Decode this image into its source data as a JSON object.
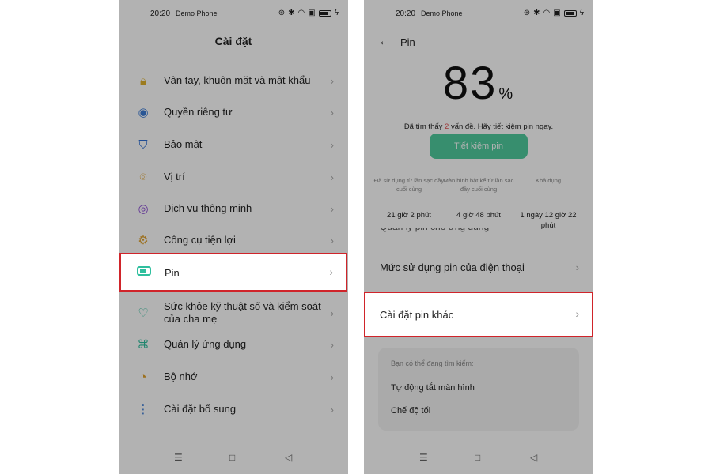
{
  "status_bar": {
    "time": "20:20",
    "carrier": "Demo Phone"
  },
  "left_screen": {
    "title": "Cài đặt",
    "items": [
      {
        "label": "Vân tay, khuôn mặt và mật khẩu",
        "icon": "lock-icon"
      },
      {
        "label": "Quyền riêng tư",
        "icon": "privacy-eye-icon"
      },
      {
        "label": "Bảo mật",
        "icon": "shield-icon"
      },
      {
        "label": "Vị trí",
        "icon": "location-pin-icon"
      },
      {
        "label": "Dịch vụ thông minh",
        "icon": "smart-service-icon"
      },
      {
        "label": "Công cụ tiện lợi",
        "icon": "tools-icon"
      },
      {
        "label": "Pin",
        "icon": "battery-icon"
      },
      {
        "label": "Sức khỏe kỹ thuật số và kiểm soát của cha mẹ",
        "icon": "heart-icon"
      },
      {
        "label": "Quản lý ứng dụng",
        "icon": "apps-grid-icon"
      },
      {
        "label": "Bộ nhớ",
        "icon": "storage-pie-icon"
      },
      {
        "label": "Cài đặt bổ sung",
        "icon": "more-dots-icon"
      }
    ]
  },
  "right_screen": {
    "title": "Pin",
    "battery_percent": "83",
    "percent_sign": "%",
    "issue_prefix": "Đã tìm thấy",
    "issue_count": "2",
    "issue_suffix": "vấn đề. Hãy tiết kiệm pin ngay.",
    "save_button": "Tiết kiệm pin",
    "stats": [
      {
        "caption": "Đã sử dụng từ lần sạc đầy cuối cùng",
        "value": "21 giờ 2 phút"
      },
      {
        "caption": "Màn hình bật kể từ lần sạc đầy cuối cùng",
        "value": "4 giờ 48 phút"
      },
      {
        "caption": "Khả dụng",
        "value": "1 ngày 12 giờ 22 phút"
      }
    ],
    "partial_row": "Quản lý pin cho ứng dụng",
    "rows": [
      {
        "label": "Mức sử dụng pin của điện thoại"
      },
      {
        "label": "Cài đặt pin khác"
      }
    ],
    "suggest_header": "Bạn có thể đang tìm kiếm:",
    "suggestions": [
      "Tự động tắt màn hình",
      "Chế độ tối"
    ]
  },
  "colors": {
    "accent_green": "#4fcc9e",
    "highlight_red": "#d0242a",
    "issue_red": "#e14b4b"
  }
}
